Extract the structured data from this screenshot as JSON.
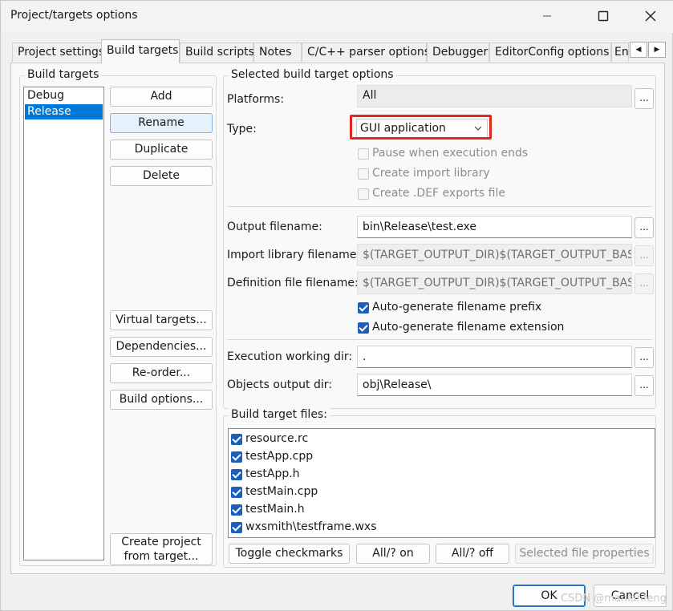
{
  "window": {
    "title": "Project/targets options"
  },
  "tabs": [
    "Project settings",
    "Build targets",
    "Build scripts",
    "Notes",
    "C/C++ parser options",
    "Debugger",
    "EditorConfig options",
    "En"
  ],
  "active_tab": "Build targets",
  "build_targets": {
    "group_title": "Build targets",
    "items": [
      "Debug",
      "Release"
    ],
    "selected": "Release",
    "buttons": {
      "add": "Add",
      "rename": "Rename",
      "duplicate": "Duplicate",
      "delete": "Delete",
      "virtual": "Virtual targets...",
      "dependencies": "Dependencies...",
      "reorder": "Re-order...",
      "build_options": "Build options...",
      "create_project_1": "Create project",
      "create_project_2": "from target..."
    }
  },
  "options": {
    "group_title": "Selected build target options",
    "platforms_label": "Platforms:",
    "platforms_value": "All",
    "type_label": "Type:",
    "type_value": "GUI application",
    "pause": "Pause when execution ends",
    "import_lib": "Create import library",
    "def_file": "Create .DEF exports file",
    "output_label": "Output filename:",
    "output_value": "bin\\Release\\test.exe",
    "import_label": "Import library filename:",
    "import_value": "$(TARGET_OUTPUT_DIR)$(TARGET_OUTPUT_BASENAME)",
    "def_label": "Definition file filename:",
    "def_value": "$(TARGET_OUTPUT_DIR)$(TARGET_OUTPUT_BASENAME)",
    "auto_prefix": "Auto-generate filename prefix",
    "auto_ext": "Auto-generate filename extension",
    "workdir_label": "Execution working dir:",
    "workdir_value": ".",
    "objdir_label": "Objects output dir:",
    "objdir_value": "obj\\Release\\",
    "browse": "..."
  },
  "files": {
    "group_title": "Build target files:",
    "items": [
      "resource.rc",
      "testApp.cpp",
      "testApp.h",
      "testMain.cpp",
      "testMain.h",
      "wxsmith\\testframe.wxs"
    ],
    "toggle": "Toggle checkmarks",
    "all_on": "All/? on",
    "all_off": "All/? off",
    "props": "Selected file properties"
  },
  "footer": {
    "ok": "OK",
    "cancel": "Cancel",
    "watermark": "CSDN @manlanfeng"
  },
  "colors": {
    "accent": "#0078d7",
    "highlight_box": "#e0271f",
    "checkbox": "#1d5fb8"
  }
}
